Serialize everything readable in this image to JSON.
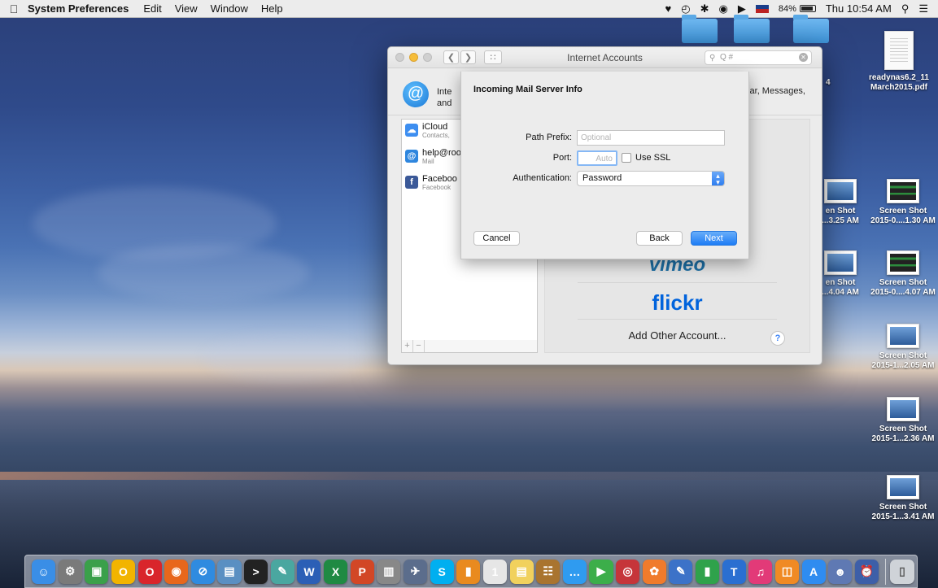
{
  "menubar": {
    "apple_icon": "apple-icon",
    "app_name": "System Preferences",
    "menus": [
      "Edit",
      "View",
      "Window",
      "Help"
    ],
    "battery_percent": "84%",
    "clock": "Thu 10:54 AM",
    "status_icons": [
      "evernote-icon",
      "time-machine-icon",
      "bluetooth-icon",
      "wifi-icon",
      "volume-icon",
      "flag-icon",
      "battery-icon",
      "spotlight-icon",
      "notification-center-icon"
    ]
  },
  "desktop": {
    "pdf_file": "readynas6.2_11 March2015.pdf",
    "pdf_line1": "readynas6.2_11",
    "pdf_line2": "March2015.pdf",
    "folder_label_fragment": "4",
    "screenshots": [
      {
        "line1": "en Shot",
        "line2": "...3.25 AM"
      },
      {
        "line1": "Screen Shot",
        "line2": "2015-0....1.30 AM"
      },
      {
        "line1": "en Shot",
        "line2": "...4.04 AM"
      },
      {
        "line1": "Screen Shot",
        "line2": "2015-0....4.07 AM"
      },
      {
        "line1": "Screen Shot",
        "line2": "2015-1...2.05 AM"
      },
      {
        "line1": "Screen Shot",
        "line2": "2015-1...2.36 AM"
      },
      {
        "line1": "Screen Shot",
        "line2": "2015-1...3.41 AM"
      }
    ]
  },
  "window": {
    "title": "Internet Accounts",
    "search_placeholder": "Q #",
    "header_text_left_1": "Inte",
    "header_text_left_2": "and",
    "header_text_right": "ar, Messages,",
    "accounts": [
      {
        "name": "iCloud",
        "sub": "Contacts,",
        "color": "#3d8ef0"
      },
      {
        "name": "help@roo",
        "sub": "Mail",
        "color": "#2e86de"
      },
      {
        "name": "Faceboo",
        "sub": "Facebook",
        "color": "#3b5998"
      }
    ],
    "list_add": "+",
    "list_remove": "−",
    "providers": {
      "vimeo": "vimeo",
      "flickr": "flickr",
      "add_other": "Add Other Account..."
    },
    "help": "?"
  },
  "sheet": {
    "title": "Incoming Mail Server Info",
    "path_prefix_label": "Path Prefix:",
    "path_prefix_placeholder": "Optional",
    "port_label": "Port:",
    "port_placeholder": "Auto",
    "use_ssl_label": "Use SSL",
    "use_ssl_checked": false,
    "auth_label": "Authentication:",
    "auth_value": "Password",
    "cancel": "Cancel",
    "back": "Back",
    "next": "Next"
  },
  "dock": {
    "items": [
      {
        "name": "finder-icon",
        "color": "#3a8ee6",
        "glyph": "☺"
      },
      {
        "name": "system-preferences-icon",
        "color": "#7a7a7a",
        "glyph": "⚙"
      },
      {
        "name": "app-store-green-icon",
        "color": "#3aa04a",
        "glyph": "▣"
      },
      {
        "name": "norton-icon",
        "color": "#f2b400",
        "glyph": "O"
      },
      {
        "name": "opera-icon",
        "color": "#d9252b",
        "glyph": "O"
      },
      {
        "name": "firefox-icon",
        "color": "#e8671c",
        "glyph": "◉"
      },
      {
        "name": "safari-icon",
        "color": "#2f8be0",
        "glyph": "⊘"
      },
      {
        "name": "preview-icon",
        "color": "#5a8fc2",
        "glyph": "▤"
      },
      {
        "name": "terminal-icon",
        "color": "#222222",
        "glyph": ">"
      },
      {
        "name": "photo-editor-icon",
        "color": "#4aa7a0",
        "glyph": "✎"
      },
      {
        "name": "word-icon",
        "color": "#2b5fb6",
        "glyph": "W"
      },
      {
        "name": "excel-icon",
        "color": "#1f8a43",
        "glyph": "X"
      },
      {
        "name": "powerpoint-icon",
        "color": "#d24726",
        "glyph": "P"
      },
      {
        "name": "notes-icon",
        "color": "#888888",
        "glyph": "▥"
      },
      {
        "name": "launchpad-icon",
        "color": "#5b6d8c",
        "glyph": "✈"
      },
      {
        "name": "skype-icon",
        "color": "#00aff0",
        "glyph": "S"
      },
      {
        "name": "books-icon",
        "color": "#e98a1f",
        "glyph": "▮"
      },
      {
        "name": "calendar-icon",
        "color": "#e6e6e6",
        "glyph": "1"
      },
      {
        "name": "stickies-icon",
        "color": "#f1d15d",
        "glyph": "▤"
      },
      {
        "name": "contacts-icon",
        "color": "#a9742f",
        "glyph": "☷"
      },
      {
        "name": "messages-icon",
        "color": "#2f9bf0",
        "glyph": "…"
      },
      {
        "name": "facetime-icon",
        "color": "#3cae4a",
        "glyph": "▶"
      },
      {
        "name": "photo-booth-icon",
        "color": "#c6353a",
        "glyph": "◎"
      },
      {
        "name": "photos-icon",
        "color": "#f07b2c",
        "glyph": "✿"
      },
      {
        "name": "preview-edit-icon",
        "color": "#3c72c8",
        "glyph": "✎"
      },
      {
        "name": "numbers-icon",
        "color": "#2fa24b",
        "glyph": "▮"
      },
      {
        "name": "keynote-icon",
        "color": "#2a6fd1",
        "glyph": "T"
      },
      {
        "name": "itunes-icon",
        "color": "#e23a78",
        "glyph": "♫"
      },
      {
        "name": "ibooks-icon",
        "color": "#f08a24",
        "glyph": "◫"
      },
      {
        "name": "app-store-icon",
        "color": "#2f8cf0",
        "glyph": "A"
      },
      {
        "name": "migration-icon",
        "color": "#5f79b3",
        "glyph": "☻"
      },
      {
        "name": "alarm-clock-icon",
        "color": "#3d5fa8",
        "glyph": "⏰"
      }
    ],
    "trash": {
      "name": "trash-icon",
      "color": "#cfd3d8",
      "glyph": "🗑"
    }
  }
}
